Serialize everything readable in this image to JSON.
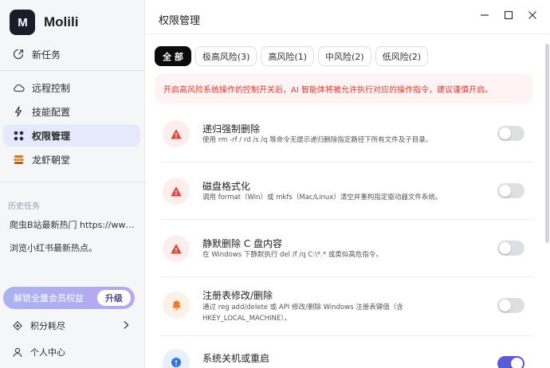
{
  "app": {
    "name": "Molili",
    "logo_text": "M"
  },
  "sidebar": {
    "new_task": "新任务",
    "items": [
      {
        "label": "远程控制",
        "icon": "cloud-icon"
      },
      {
        "label": "技能配置",
        "icon": "lightning-icon"
      },
      {
        "label": "权限管理",
        "icon": "permission-grid-icon",
        "active": true
      },
      {
        "label": "龙虾朝堂",
        "icon": "throne-icon"
      }
    ],
    "history_title": "历史任务",
    "history": [
      "爬虫B站最新热门 https://www.bilibili.com",
      "浏览小红书最新热点。"
    ],
    "upgrade": {
      "label": "解锁全量会员权益",
      "button": "升级"
    },
    "points": "积分耗尽",
    "profile": "个人中心"
  },
  "main": {
    "title": "权限管理",
    "tabs": [
      {
        "label": "全 部",
        "active": true
      },
      {
        "label": "极高风险(3)"
      },
      {
        "label": "高风险(1)"
      },
      {
        "label": "中风险(2)"
      },
      {
        "label": "低风险(2)"
      }
    ],
    "warning": "开启高风险系统操作的控制开关后，AI 智能体将被允许执行对应的操作指令，建议谨慎开启。",
    "permissions": [
      {
        "title": "递归强制删除",
        "desc": "使用 rm -rf / rd /s /q 等命令无提示递归删除指定路径下所有文件及子目录。",
        "icon": "warning-triangle-icon",
        "enabled": false
      },
      {
        "title": "磁盘格式化",
        "desc": "调用 format（Win）或 mkfs（Mac/Linux）清空并重构指定驱动器文件系统。",
        "icon": "warning-triangle-icon",
        "enabled": false
      },
      {
        "title": "静默删除 C 盘内容",
        "desc": "在 Windows 下静默执行 del /f /q C:\\*.* 或类似高危指令。",
        "icon": "warning-triangle-icon",
        "enabled": false
      },
      {
        "title": "注册表修改/删除",
        "desc": "通过 reg add/delete 或 API 修改/删除 Windows 注册表键值（含 HKEY_LOCAL_MACHINE）。",
        "icon": "bell-icon",
        "enabled": false
      },
      {
        "title": "系统关机或重启",
        "desc": "",
        "icon": "info-icon",
        "enabled": true
      }
    ]
  },
  "colors": {
    "accent": "#5b5bd6",
    "danger": "#e04a3f",
    "warning_bg": "#fff4f3",
    "active_nav": "#e6e8fb"
  }
}
